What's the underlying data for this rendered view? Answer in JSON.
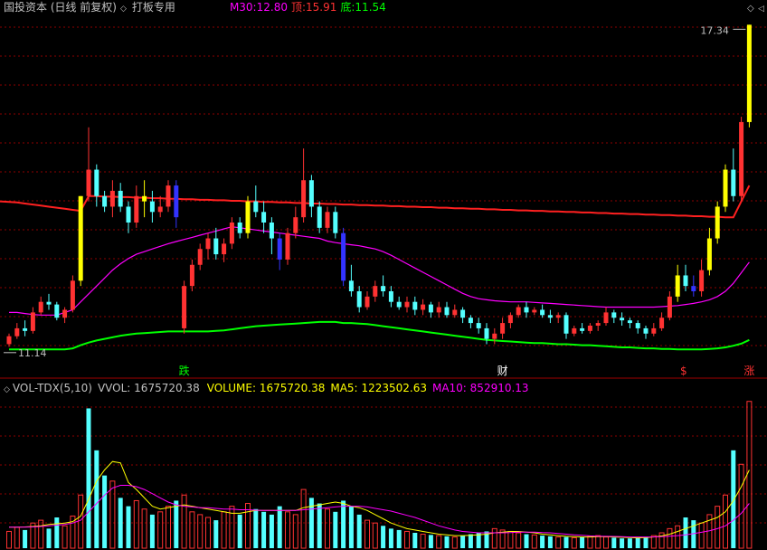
{
  "colors": {
    "up": "#ff3232",
    "down": "#54ffff",
    "yellow": "#ffff00",
    "blue": "#3333ff",
    "ma30": "#ff2020",
    "top_line": "#ff00ff",
    "bottom_line": "#00ff00",
    "ma5_vol": "#ffff00",
    "ma10_vol": "#ff00ff",
    "grid": "#8b0000",
    "axis_text": "#c0c0c0",
    "title": "#c0c0c0"
  },
  "header": {
    "stock_title": "国投资本 (日线 前复权)",
    "indicator_name": "打板专用",
    "ma30_label": "M30:",
    "ma30_value": "12.80",
    "top_label": "顶:",
    "top_value": "15.91",
    "bottom_label": "底:",
    "bottom_value": "11.54"
  },
  "vol_header": {
    "name": "VOL-TDX(5,10)",
    "vvol_label": "VVOL:",
    "vvol_value": "1675720.38",
    "volume_label": "VOLUME:",
    "volume_value": "1675720.38",
    "ma5_label": "MA5:",
    "ma5_value": "1223502.63",
    "ma10_label": "MA10:",
    "ma10_value": "852910.13"
  },
  "chart_data": {
    "type": "candlestick",
    "price_high_label": "17.34",
    "price_low_label": "11.14",
    "price_range": [
      11.14,
      17.34
    ],
    "markers": [
      {
        "text": "跌",
        "index": 22,
        "color": "#00ff00"
      },
      {
        "text": "财",
        "index": 62,
        "color": "#ffffff"
      },
      {
        "text": "$",
        "index": 85,
        "color": "#ff3232"
      },
      {
        "text": "涨",
        "index": 93,
        "color": "#ff3232"
      }
    ],
    "candles": [
      [
        11.3,
        11.45,
        11.25,
        11.5
      ],
      [
        11.45,
        11.6,
        11.4,
        11.7
      ],
      [
        11.6,
        11.55,
        11.45,
        11.75
      ],
      [
        11.55,
        11.9,
        11.5,
        12.0
      ],
      [
        11.9,
        12.1,
        11.85,
        12.2
      ],
      [
        12.1,
        12.05,
        11.95,
        12.25
      ],
      [
        12.05,
        11.8,
        11.75,
        12.1
      ],
      [
        11.8,
        11.95,
        11.7,
        12.0
      ],
      [
        11.95,
        12.5,
        11.9,
        12.6
      ],
      [
        12.5,
        14.1,
        12.4,
        14.1
      ],
      [
        14.1,
        14.6,
        14.0,
        15.4
      ],
      [
        14.6,
        14.1,
        13.9,
        14.7
      ],
      [
        14.1,
        13.9,
        13.8,
        14.2
      ],
      [
        13.9,
        14.2,
        13.7,
        14.4
      ],
      [
        14.2,
        13.9,
        13.8,
        14.35
      ],
      [
        13.9,
        13.6,
        13.4,
        14.0
      ],
      [
        13.6,
        14.1,
        13.5,
        14.3
      ],
      [
        14.1,
        14.0,
        13.7,
        14.4
      ],
      [
        14.0,
        13.8,
        13.6,
        14.2
      ],
      [
        13.8,
        13.9,
        13.7,
        14.1
      ],
      [
        13.9,
        14.3,
        13.8,
        14.4
      ],
      [
        14.3,
        13.7,
        13.5,
        14.4
      ],
      [
        11.6,
        12.4,
        11.5,
        12.5
      ],
      [
        12.4,
        12.8,
        12.3,
        12.9
      ],
      [
        12.8,
        13.1,
        12.7,
        13.2
      ],
      [
        13.1,
        13.3,
        12.9,
        13.4
      ],
      [
        13.3,
        13.0,
        12.9,
        13.5
      ],
      [
        13.0,
        13.2,
        12.85,
        13.3
      ],
      [
        13.2,
        13.6,
        13.1,
        13.7
      ],
      [
        13.6,
        13.4,
        13.3,
        13.7
      ],
      [
        13.4,
        14.0,
        13.3,
        14.1
      ],
      [
        14.0,
        13.8,
        13.7,
        14.3
      ],
      [
        13.8,
        13.6,
        13.4,
        14.0
      ],
      [
        13.6,
        13.3,
        13.0,
        13.7
      ],
      [
        13.3,
        12.9,
        12.7,
        13.4
      ],
      [
        12.9,
        13.4,
        12.8,
        13.5
      ],
      [
        13.4,
        13.7,
        13.3,
        13.9
      ],
      [
        13.7,
        14.4,
        13.6,
        15.0
      ],
      [
        14.4,
        13.9,
        13.7,
        14.5
      ],
      [
        13.9,
        13.5,
        13.4,
        14.0
      ],
      [
        13.5,
        13.8,
        13.4,
        13.9
      ],
      [
        13.8,
        13.4,
        13.3,
        13.9
      ],
      [
        13.4,
        12.5,
        12.4,
        13.5
      ],
      [
        12.5,
        12.3,
        12.2,
        12.8
      ],
      [
        12.3,
        12.0,
        11.9,
        12.4
      ],
      [
        12.0,
        12.2,
        11.95,
        12.3
      ],
      [
        12.2,
        12.4,
        12.1,
        12.5
      ],
      [
        12.4,
        12.3,
        12.2,
        12.6
      ],
      [
        12.3,
        12.1,
        12.0,
        12.4
      ],
      [
        12.1,
        12.0,
        11.95,
        12.2
      ],
      [
        12.0,
        12.1,
        11.9,
        12.2
      ],
      [
        12.1,
        11.95,
        11.85,
        12.2
      ],
      [
        11.95,
        12.05,
        11.85,
        12.15
      ],
      [
        12.05,
        11.9,
        11.8,
        12.1
      ],
      [
        11.9,
        12.0,
        11.8,
        12.1
      ],
      [
        12.0,
        11.85,
        11.8,
        12.1
      ],
      [
        11.85,
        11.95,
        11.8,
        12.05
      ],
      [
        11.95,
        11.8,
        11.7,
        12.0
      ],
      [
        11.8,
        11.7,
        11.6,
        11.85
      ],
      [
        11.7,
        11.6,
        11.5,
        11.8
      ],
      [
        11.6,
        11.4,
        11.3,
        11.7
      ],
      [
        11.4,
        11.5,
        11.3,
        11.6
      ],
      [
        11.5,
        11.7,
        11.4,
        11.8
      ],
      [
        11.7,
        11.85,
        11.6,
        11.9
      ],
      [
        11.85,
        12.0,
        11.8,
        12.05
      ],
      [
        12.0,
        11.9,
        11.8,
        12.1
      ],
      [
        11.9,
        11.95,
        11.85,
        12.0
      ],
      [
        11.95,
        11.85,
        11.8,
        12.05
      ],
      [
        11.85,
        11.8,
        11.7,
        11.95
      ],
      [
        11.8,
        11.85,
        11.7,
        11.9
      ],
      [
        11.85,
        11.5,
        11.4,
        11.9
      ],
      [
        11.5,
        11.6,
        11.45,
        11.65
      ],
      [
        11.6,
        11.55,
        11.5,
        11.7
      ],
      [
        11.55,
        11.65,
        11.5,
        11.7
      ],
      [
        11.65,
        11.7,
        11.55,
        11.75
      ],
      [
        11.7,
        11.9,
        11.65,
        12.0
      ],
      [
        11.9,
        11.8,
        11.7,
        11.95
      ],
      [
        11.8,
        11.75,
        11.65,
        11.9
      ],
      [
        11.75,
        11.7,
        11.6,
        11.8
      ],
      [
        11.7,
        11.6,
        11.5,
        11.75
      ],
      [
        11.6,
        11.5,
        11.4,
        11.65
      ],
      [
        11.5,
        11.6,
        11.45,
        11.7
      ],
      [
        11.6,
        11.8,
        11.55,
        11.9
      ],
      [
        11.8,
        12.2,
        11.75,
        12.3
      ],
      [
        12.2,
        12.6,
        12.1,
        12.8
      ],
      [
        12.6,
        12.4,
        12.3,
        12.8
      ],
      [
        12.4,
        12.3,
        12.2,
        12.6
      ],
      [
        12.3,
        12.7,
        12.2,
        12.9
      ],
      [
        12.7,
        13.3,
        12.6,
        13.5
      ],
      [
        13.3,
        13.9,
        13.2,
        14.0
      ],
      [
        13.9,
        14.6,
        13.8,
        14.7
      ],
      [
        14.6,
        14.1,
        14.0,
        15.0
      ],
      [
        14.1,
        15.5,
        14.0,
        15.6
      ],
      [
        15.5,
        17.34,
        15.4,
        17.34
      ]
    ],
    "candle_style": [
      "up",
      "up",
      "down",
      "up",
      "up",
      "down",
      "down",
      "up",
      "up",
      "yellow",
      "up",
      "down",
      "down",
      "up",
      "down",
      "down",
      "up",
      "yellow",
      "down",
      "up",
      "up",
      "blue",
      "up",
      "up",
      "up",
      "up",
      "down",
      "up",
      "up",
      "down",
      "yellow",
      "down",
      "down",
      "down",
      "blue",
      "up",
      "up",
      "up",
      "down",
      "down",
      "up",
      "down",
      "blue",
      "down",
      "down",
      "up",
      "up",
      "down",
      "down",
      "down",
      "up",
      "down",
      "up",
      "down",
      "up",
      "down",
      "up",
      "down",
      "down",
      "down",
      "down",
      "up",
      "up",
      "up",
      "up",
      "down",
      "up",
      "down",
      "down",
      "up",
      "down",
      "up",
      "down",
      "up",
      "up",
      "up",
      "down",
      "down",
      "down",
      "down",
      "down",
      "up",
      "up",
      "up",
      "yellow",
      "down",
      "blue",
      "up",
      "yellow",
      "yellow",
      "yellow",
      "down",
      "up",
      "yellow"
    ],
    "ma30_line": [
      14.0,
      13.98,
      13.96,
      13.94,
      13.92,
      13.9,
      13.88,
      13.86,
      13.84,
      13.82,
      14.1,
      14.1,
      14.09,
      14.09,
      14.08,
      14.08,
      14.07,
      14.07,
      14.06,
      14.06,
      14.05,
      14.05,
      14.04,
      14.04,
      14.03,
      14.03,
      14.02,
      14.02,
      14.01,
      14.01,
      14.0,
      14.0,
      13.99,
      13.99,
      13.98,
      13.98,
      13.97,
      13.97,
      13.96,
      13.96,
      13.95,
      13.95,
      13.94,
      13.94,
      13.93,
      13.93,
      13.92,
      13.92,
      13.91,
      13.91,
      13.9,
      13.9,
      13.89,
      13.89,
      13.88,
      13.88,
      13.87,
      13.87,
      13.86,
      13.86,
      13.85,
      13.85,
      13.84,
      13.84,
      13.83,
      13.83,
      13.82,
      13.82,
      13.81,
      13.81,
      13.8,
      13.8,
      13.79,
      13.79,
      13.78,
      13.78,
      13.77,
      13.77,
      13.76,
      13.76,
      13.75,
      13.75,
      13.74,
      13.74,
      13.73,
      13.73,
      13.72,
      13.72,
      13.71,
      13.71,
      13.7,
      13.7,
      14.0,
      14.3
    ],
    "top_line": [
      11.9,
      11.9,
      11.88,
      11.86,
      11.85,
      11.85,
      11.85,
      11.9,
      11.95,
      12.1,
      12.25,
      12.4,
      12.55,
      12.7,
      12.82,
      12.92,
      13.0,
      13.05,
      13.1,
      13.15,
      13.2,
      13.24,
      13.28,
      13.32,
      13.36,
      13.4,
      13.44,
      13.48,
      13.52,
      13.5,
      13.48,
      13.46,
      13.44,
      13.42,
      13.4,
      13.38,
      13.36,
      13.34,
      13.32,
      13.3,
      13.25,
      13.22,
      13.2,
      13.18,
      13.16,
      13.13,
      13.1,
      13.05,
      12.98,
      12.9,
      12.82,
      12.74,
      12.66,
      12.58,
      12.5,
      12.42,
      12.34,
      12.26,
      12.2,
      12.16,
      12.14,
      12.12,
      12.11,
      12.1,
      12.1,
      12.1,
      12.09,
      12.08,
      12.07,
      12.06,
      12.05,
      12.04,
      12.03,
      12.02,
      12.01,
      12.0,
      12.0,
      12.0,
      12.0,
      12.0,
      12.0,
      12.0,
      12.01,
      12.02,
      12.03,
      12.05,
      12.07,
      12.1,
      12.14,
      12.2,
      12.3,
      12.45,
      12.65,
      12.85
    ],
    "bottom_line": [
      11.2,
      11.2,
      11.2,
      11.2,
      11.2,
      11.2,
      11.2,
      11.2,
      11.22,
      11.28,
      11.33,
      11.37,
      11.4,
      11.43,
      11.46,
      11.48,
      11.5,
      11.51,
      11.52,
      11.53,
      11.54,
      11.54,
      11.54,
      11.54,
      11.54,
      11.54,
      11.55,
      11.56,
      11.58,
      11.6,
      11.62,
      11.64,
      11.65,
      11.66,
      11.67,
      11.68,
      11.69,
      11.7,
      11.71,
      11.72,
      11.72,
      11.72,
      11.7,
      11.7,
      11.69,
      11.68,
      11.66,
      11.64,
      11.62,
      11.6,
      11.58,
      11.56,
      11.54,
      11.52,
      11.5,
      11.48,
      11.46,
      11.44,
      11.42,
      11.4,
      11.38,
      11.37,
      11.36,
      11.35,
      11.34,
      11.33,
      11.32,
      11.32,
      11.31,
      11.3,
      11.3,
      11.29,
      11.28,
      11.28,
      11.27,
      11.26,
      11.25,
      11.24,
      11.24,
      11.23,
      11.22,
      11.22,
      11.21,
      11.21,
      11.2,
      11.2,
      11.2,
      11.2,
      11.21,
      11.22,
      11.24,
      11.27,
      11.31,
      11.38
    ],
    "volume": {
      "values": [
        120,
        150,
        130,
        180,
        200,
        140,
        220,
        160,
        230,
        380,
        1000,
        700,
        520,
        480,
        360,
        300,
        340,
        280,
        240,
        260,
        300,
        340,
        380,
        260,
        240,
        220,
        200,
        260,
        300,
        240,
        320,
        280,
        260,
        240,
        300,
        260,
        240,
        420,
        360,
        320,
        280,
        260,
        340,
        300,
        240,
        200,
        180,
        160,
        140,
        130,
        120,
        110,
        100,
        95,
        90,
        85,
        80,
        90,
        100,
        110,
        120,
        140,
        130,
        120,
        110,
        100,
        95,
        90,
        85,
        80,
        80,
        75,
        80,
        85,
        90,
        80,
        75,
        70,
        70,
        75,
        80,
        90,
        110,
        140,
        160,
        220,
        200,
        180,
        240,
        300,
        380,
        700,
        600,
        1050
      ],
      "styles": [
        "up",
        "up",
        "down",
        "up",
        "up",
        "down",
        "down",
        "up",
        "up",
        "up",
        "down",
        "down",
        "down",
        "up",
        "down",
        "down",
        "up",
        "up",
        "down",
        "up",
        "up",
        "down",
        "up",
        "up",
        "up",
        "up",
        "down",
        "up",
        "up",
        "down",
        "up",
        "down",
        "down",
        "down",
        "down",
        "up",
        "up",
        "up",
        "down",
        "down",
        "up",
        "down",
        "down",
        "down",
        "down",
        "up",
        "up",
        "down",
        "down",
        "down",
        "up",
        "down",
        "up",
        "down",
        "up",
        "down",
        "up",
        "down",
        "down",
        "down",
        "down",
        "up",
        "up",
        "up",
        "up",
        "down",
        "up",
        "down",
        "down",
        "up",
        "down",
        "up",
        "down",
        "up",
        "up",
        "up",
        "down",
        "down",
        "down",
        "down",
        "down",
        "up",
        "up",
        "up",
        "up",
        "down",
        "down",
        "up",
        "up",
        "up",
        "up",
        "down",
        "up",
        "up"
      ],
      "ma5": [
        150,
        150,
        152,
        155,
        160,
        170,
        175,
        180,
        190,
        230,
        350,
        480,
        560,
        620,
        610,
        470,
        420,
        360,
        300,
        280,
        290,
        300,
        310,
        300,
        290,
        280,
        270,
        260,
        250,
        250,
        260,
        270,
        270,
        270,
        270,
        270,
        270,
        290,
        300,
        310,
        320,
        330,
        320,
        300,
        290,
        270,
        240,
        210,
        180,
        160,
        140,
        130,
        120,
        110,
        100,
        95,
        90,
        90,
        92,
        95,
        100,
        110,
        115,
        120,
        120,
        115,
        110,
        100,
        95,
        90,
        85,
        82,
        80,
        80,
        82,
        82,
        80,
        78,
        76,
        74,
        76,
        80,
        88,
        100,
        120,
        140,
        160,
        180,
        200,
        220,
        260,
        340,
        440,
        560
      ],
      "ma10": [
        150,
        150,
        150,
        152,
        155,
        160,
        165,
        170,
        180,
        200,
        260,
        320,
        380,
        430,
        450,
        450,
        440,
        420,
        390,
        360,
        330,
        310,
        300,
        295,
        290,
        290,
        285,
        280,
        280,
        275,
        275,
        272,
        270,
        270,
        270,
        270,
        270,
        275,
        280,
        285,
        290,
        295,
        300,
        300,
        300,
        295,
        285,
        275,
        265,
        250,
        235,
        220,
        200,
        180,
        160,
        145,
        130,
        120,
        115,
        110,
        110,
        110,
        110,
        112,
        115,
        115,
        115,
        112,
        110,
        105,
        100,
        95,
        92,
        88,
        86,
        85,
        84,
        82,
        80,
        80,
        80,
        81,
        83,
        86,
        90,
        96,
        104,
        114,
        125,
        140,
        160,
        200,
        250,
        320
      ],
      "max": 1100
    }
  }
}
